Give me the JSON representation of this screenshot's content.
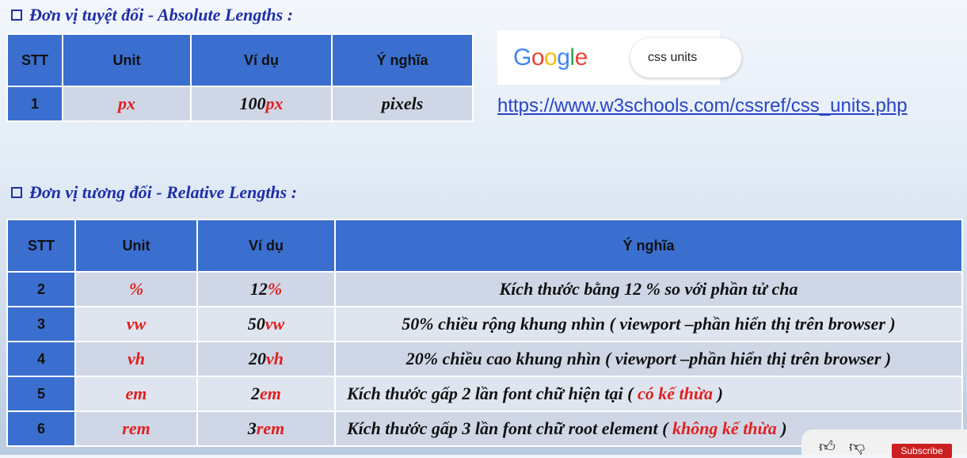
{
  "absolute": {
    "heading": "Đơn vị tuyệt đối - Absolute Lengths :",
    "headers": [
      "STT",
      "Unit",
      "Ví dụ",
      "Ý nghĩa"
    ],
    "rows": [
      {
        "stt": "1",
        "unit": "px",
        "example_num": "100",
        "example_unit": "px",
        "meaning": "pixels"
      }
    ]
  },
  "google": {
    "logo": [
      "G",
      "o",
      "o",
      "g",
      "l",
      "e"
    ],
    "logo_colors": [
      "#4285f4",
      "#ea4335",
      "#fbbc05",
      "#4285f4",
      "#34a853",
      "#ea4335"
    ],
    "search_text": "css units"
  },
  "link": "https://www.w3schools.com/cssref/css_units.php",
  "relative": {
    "heading": "Đơn vị tương đối - Relative Lengths :",
    "headers": [
      "STT",
      "Unit",
      "Ví dụ",
      "Ý nghĩa"
    ],
    "rows": [
      {
        "stt": "2",
        "unit": "%",
        "example_num": "12",
        "example_unit": "%",
        "meaning_main": "Kích thước bằng 12 % so với phần tử cha",
        "meaning_red": "",
        "meaning_tail": ""
      },
      {
        "stt": "3",
        "unit": "vw",
        "example_num": "50",
        "example_unit": "vw",
        "meaning_main": "50% chiều rộng khung nhìn ( viewport –phần hiển thị trên browser )",
        "meaning_red": "",
        "meaning_tail": ""
      },
      {
        "stt": "4",
        "unit": "vh",
        "example_num": "20",
        "example_unit": "vh",
        "meaning_main": "20% chiều cao khung nhìn ( viewport –phần hiển thị trên browser )",
        "meaning_red": "",
        "meaning_tail": ""
      },
      {
        "stt": "5",
        "unit": "em",
        "example_num": "2",
        "example_unit": "em",
        "meaning_main": "Kích thước gấp 2 lần font chữ hiện tại ( ",
        "meaning_red": "có kế thừa",
        "meaning_tail": " )"
      },
      {
        "stt": "6",
        "unit": "rem",
        "example_num": "3",
        "example_unit": "rem",
        "meaning_main": "Kích thước gấp 3 lần font chữ root element ( ",
        "meaning_red": "không kế thừa",
        "meaning_tail": " )"
      }
    ]
  },
  "youtube": {
    "subscribe_label": "Subscribe",
    "like_icon": "thumbs-up-icon",
    "dislike_icon": "thumbs-down-icon"
  }
}
